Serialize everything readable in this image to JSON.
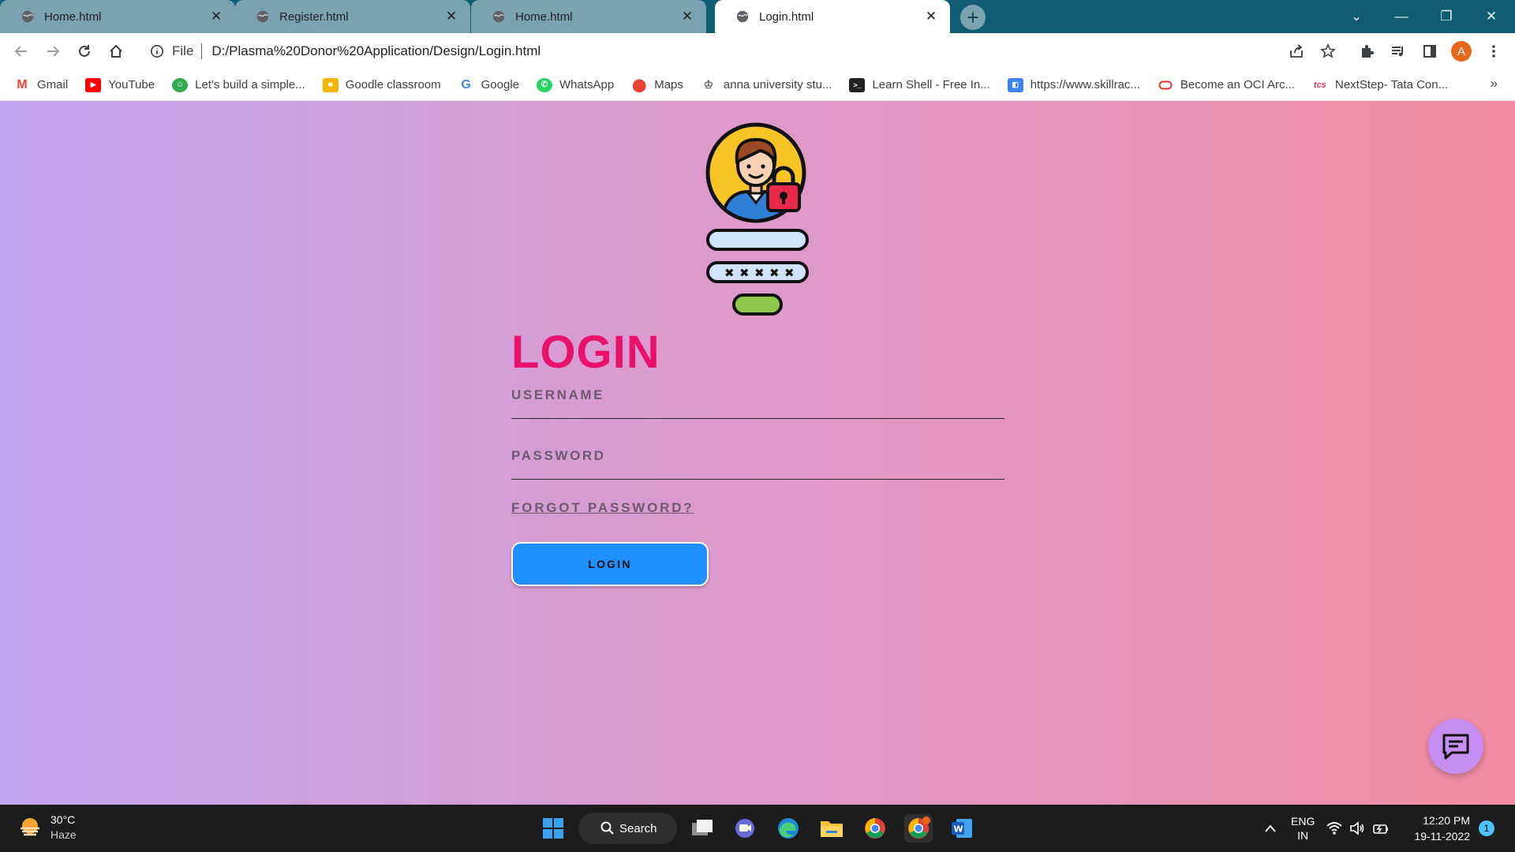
{
  "browser": {
    "tabs": [
      {
        "title": "Home.html",
        "active": false
      },
      {
        "title": "Register.html",
        "active": false
      },
      {
        "title": "Home.html",
        "active": false
      },
      {
        "title": "Login.html",
        "active": true
      }
    ],
    "address_scheme": "File",
    "address_url": "D:/Plasma%20Donor%20Application/Design/Login.html",
    "profile_initial": "A",
    "bookmarks": [
      {
        "label": "Gmail",
        "icon": "gmail-icon",
        "color": "#ea4335"
      },
      {
        "label": "YouTube",
        "icon": "youtube-icon",
        "color": "#ff0000"
      },
      {
        "label": "Let's build a simple...",
        "icon": "chatbot-icon",
        "color": "#34a853"
      },
      {
        "label": "Goodle classroom",
        "icon": "classroom-icon",
        "color": "#f4b400"
      },
      {
        "label": "Google",
        "icon": "google-icon",
        "color": "#4285f4"
      },
      {
        "label": "WhatsApp",
        "icon": "whatsapp-icon",
        "color": "#25d366"
      },
      {
        "label": "Maps",
        "icon": "maps-icon",
        "color": "#ea4335"
      },
      {
        "label": "anna university stu...",
        "icon": "university-icon",
        "color": "#777777"
      },
      {
        "label": "Learn Shell - Free In...",
        "icon": "terminal-icon",
        "color": "#222222"
      },
      {
        "label": "https://www.skillrac...",
        "icon": "skillrack-icon",
        "color": "#3b82f6"
      },
      {
        "label": "Become an OCI Arc...",
        "icon": "oracle-icon",
        "color": "#e0392b"
      },
      {
        "label": "NextStep- Tata Con...",
        "icon": "tcs-icon",
        "color": "#d63a5c"
      }
    ],
    "bookmarks_more": "»"
  },
  "page": {
    "title": "LOGIN",
    "username_label": "USERNAME",
    "password_label": "PASSWORD",
    "forgot_link": "FORGOT PASSWORD?",
    "login_button": "LOGIN",
    "colors": {
      "title": "#e8126a",
      "button": "#1e90ff",
      "gradient_left": "#c0a5ee",
      "gradient_right": "#f28ca3"
    }
  },
  "taskbar": {
    "weather_temp": "30°C",
    "weather_desc": "Haze",
    "search_label": "Search",
    "lang_1": "ENG",
    "lang_2": "IN",
    "time": "12:20 PM",
    "date": "19-11-2022",
    "notifications": "1"
  }
}
